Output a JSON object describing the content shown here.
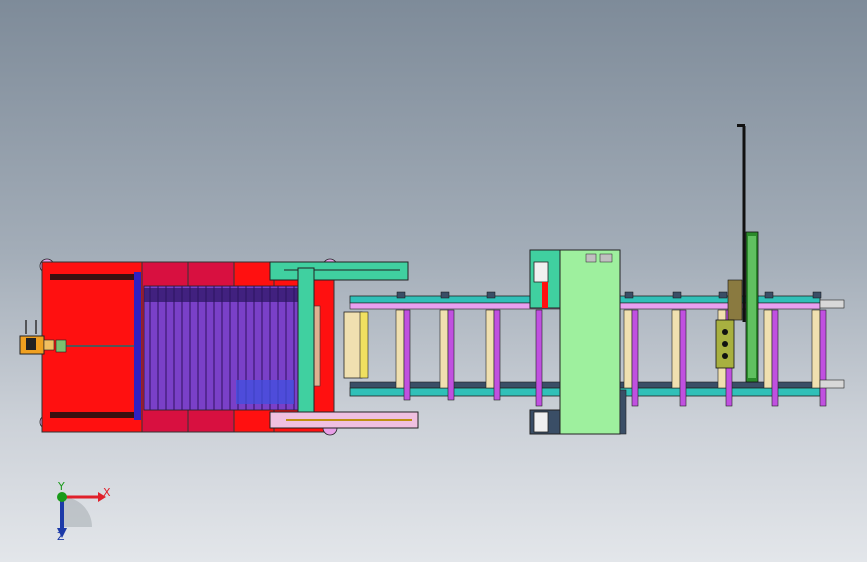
{
  "viewport": {
    "background_top": "#7e8b99",
    "background_bottom": "#e3e6ea"
  },
  "model": {
    "colors": {
      "frame_red": "#ff1010",
      "frame_dark_red": "#d81040",
      "purple_rolls": "#7a40c8",
      "blue_rail": "#3020c0",
      "green_top": "#40d0a0",
      "green_block": "#9ef09e",
      "conveyor_teal": "#30c0b8",
      "conveyor_pink": "#e8a0f0",
      "yellow_post": "#f0e060",
      "cream_post": "#f0e0b0",
      "orange_motor": "#f0a020",
      "slate": "#3a4e66"
    }
  },
  "triad": {
    "x_label": "X",
    "y_label": "Y",
    "z_label": "Z",
    "x_color": "#e0202a",
    "y_color": "#1a9a1a",
    "z_color": "#1c3aa8"
  }
}
